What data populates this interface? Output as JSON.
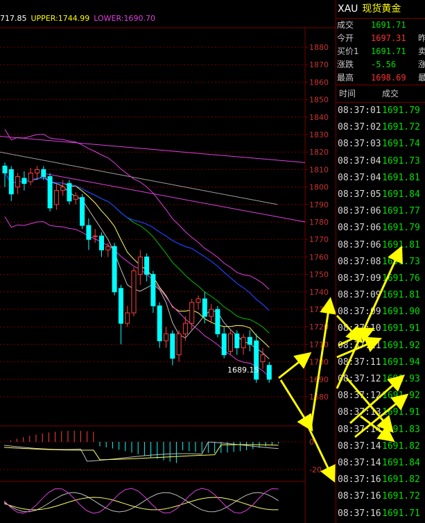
{
  "indicator": {
    "mid": "717.85",
    "upper_label": "UPPER:",
    "upper_value": "1744.99",
    "lower_label": "LOWER:",
    "lower_value": "1690.70"
  },
  "price_axis": {
    "ticks": [
      "1880",
      "1870",
      "1860",
      "1850",
      "1840",
      "1830",
      "1820",
      "1810",
      "1800",
      "1790",
      "1780",
      "1770",
      "1760",
      "1750",
      "1740",
      "1730",
      "1720",
      "1710",
      "1700",
      "1690",
      "1680"
    ]
  },
  "last_price_label": "1689.15",
  "macd_axis": {
    "ticks": [
      "0",
      "-20"
    ]
  },
  "colors": {
    "grid": "#7a0000",
    "axis_text": "#c83232",
    "candle_down": "#00ffff",
    "candle_up": "#ff4040",
    "ma_white": "#c0c0c0",
    "ma_yellow": "#ffff60",
    "ma_green": "#00c000",
    "ma_blue": "#2040ff",
    "boll_magenta": "#e040e0",
    "annotation_arrow": "#ffff00",
    "price_green": "#00e000",
    "price_red": "#ff3030"
  },
  "quote": {
    "code": "XAU",
    "name": "现货黄金",
    "rows": [
      {
        "label": "成交",
        "value": "1691.71",
        "color": "#00e000",
        "extra": ""
      },
      {
        "label": "今开",
        "value": "1697.31",
        "color": "#ff3030",
        "extra": "昨"
      },
      {
        "label": "买价1",
        "value": "1691.71",
        "color": "#00e000",
        "extra": "卖"
      },
      {
        "label": "涨跌",
        "value": "-5.56",
        "color": "#00e000",
        "extra": "涨"
      },
      {
        "label": "最高",
        "value": "1698.69",
        "color": "#ff3030",
        "extra": "最"
      }
    ]
  },
  "ticks_table": {
    "header_time": "时间",
    "header_price": "成交",
    "rows": [
      {
        "time": "08:37:01",
        "price": "1691.79"
      },
      {
        "time": "08:37:02",
        "price": "1691.72"
      },
      {
        "time": "08:37:03",
        "price": "1691.74"
      },
      {
        "time": "08:37:04",
        "price": "1691.73"
      },
      {
        "time": "08:37:04",
        "price": "1691.81"
      },
      {
        "time": "08:37:05",
        "price": "1691.84"
      },
      {
        "time": "08:37:06",
        "price": "1691.77"
      },
      {
        "time": "08:37:06",
        "price": "1691.79"
      },
      {
        "time": "08:37:06",
        "price": "1691.81"
      },
      {
        "time": "08:37:08",
        "price": "1691.73"
      },
      {
        "time": "08:37:09",
        "price": "1691.76"
      },
      {
        "time": "08:37:09",
        "price": "1691.81"
      },
      {
        "time": "08:37:09",
        "price": "1691.90"
      },
      {
        "time": "08:37:10",
        "price": "1691.91"
      },
      {
        "time": "08:37:11",
        "price": "1691.92"
      },
      {
        "time": "08:37:11",
        "price": "1691.94"
      },
      {
        "time": "08:37:12",
        "price": "1691.93"
      },
      {
        "time": "08:37:12",
        "price": "1691.92"
      },
      {
        "time": "08:37:13",
        "price": "1691.91"
      },
      {
        "time": "08:37:14",
        "price": "1691.83"
      },
      {
        "time": "08:37:14",
        "price": "1691.82"
      },
      {
        "time": "08:37:14",
        "price": "1691.84"
      },
      {
        "time": "08:37:16",
        "price": "1691.82"
      },
      {
        "time": "08:37:16",
        "price": "1691.72"
      },
      {
        "time": "08:37:16",
        "price": "1691.71"
      }
    ]
  },
  "candles": [
    {
      "o": 1812,
      "c": 1808,
      "h": 1814,
      "l": 1800
    },
    {
      "o": 1810,
      "c": 1796,
      "h": 1812,
      "l": 1792
    },
    {
      "o": 1800,
      "c": 1806,
      "h": 1808,
      "l": 1796
    },
    {
      "o": 1805,
      "c": 1802,
      "h": 1809,
      "l": 1798
    },
    {
      "o": 1803,
      "c": 1808,
      "h": 1811,
      "l": 1801
    },
    {
      "o": 1808,
      "c": 1810,
      "h": 1812,
      "l": 1805
    },
    {
      "o": 1810,
      "c": 1806,
      "h": 1812,
      "l": 1804
    },
    {
      "o": 1806,
      "c": 1788,
      "h": 1808,
      "l": 1786
    },
    {
      "o": 1790,
      "c": 1798,
      "h": 1802,
      "l": 1787
    },
    {
      "o": 1798,
      "c": 1800,
      "h": 1804,
      "l": 1795
    },
    {
      "o": 1802,
      "c": 1792,
      "h": 1804,
      "l": 1790
    },
    {
      "o": 1793,
      "c": 1795,
      "h": 1797,
      "l": 1790
    },
    {
      "o": 1794,
      "c": 1778,
      "h": 1796,
      "l": 1776
    },
    {
      "o": 1778,
      "c": 1770,
      "h": 1782,
      "l": 1764
    },
    {
      "o": 1772,
      "c": 1772,
      "h": 1776,
      "l": 1768
    },
    {
      "o": 1772,
      "c": 1764,
      "h": 1774,
      "l": 1760
    },
    {
      "o": 1764,
      "c": 1766,
      "h": 1768,
      "l": 1760
    },
    {
      "o": 1766,
      "c": 1740,
      "h": 1768,
      "l": 1738
    },
    {
      "o": 1742,
      "c": 1722,
      "h": 1744,
      "l": 1710
    },
    {
      "o": 1722,
      "c": 1728,
      "h": 1732,
      "l": 1720
    },
    {
      "o": 1728,
      "c": 1752,
      "h": 1754,
      "l": 1726
    },
    {
      "o": 1750,
      "c": 1760,
      "h": 1764,
      "l": 1744
    },
    {
      "o": 1760,
      "c": 1750,
      "h": 1762,
      "l": 1746
    },
    {
      "o": 1750,
      "c": 1732,
      "h": 1752,
      "l": 1728
    },
    {
      "o": 1732,
      "c": 1712,
      "h": 1734,
      "l": 1708
    },
    {
      "o": 1712,
      "c": 1716,
      "h": 1720,
      "l": 1708
    },
    {
      "o": 1716,
      "c": 1702,
      "h": 1718,
      "l": 1698
    },
    {
      "o": 1704,
      "c": 1716,
      "h": 1718,
      "l": 1700
    },
    {
      "o": 1716,
      "c": 1722,
      "h": 1726,
      "l": 1712
    },
    {
      "o": 1722,
      "c": 1734,
      "h": 1736,
      "l": 1718
    },
    {
      "o": 1734,
      "c": 1736,
      "h": 1738,
      "l": 1730
    },
    {
      "o": 1736,
      "c": 1726,
      "h": 1740,
      "l": 1722
    },
    {
      "o": 1726,
      "c": 1730,
      "h": 1733,
      "l": 1722
    },
    {
      "o": 1730,
      "c": 1716,
      "h": 1732,
      "l": 1714
    },
    {
      "o": 1716,
      "c": 1704,
      "h": 1720,
      "l": 1702
    },
    {
      "o": 1706,
      "c": 1716,
      "h": 1718,
      "l": 1704
    },
    {
      "o": 1716,
      "c": 1708,
      "h": 1718,
      "l": 1704
    },
    {
      "o": 1708,
      "c": 1714,
      "h": 1716,
      "l": 1704
    },
    {
      "o": 1714,
      "c": 1710,
      "h": 1718,
      "l": 1706
    },
    {
      "o": 1712,
      "c": 1690,
      "h": 1716,
      "l": 1688
    },
    {
      "o": 1700,
      "c": 1704,
      "h": 1708,
      "l": 1696
    },
    {
      "o": 1698,
      "c": 1690,
      "h": 1700,
      "l": 1688
    }
  ]
}
